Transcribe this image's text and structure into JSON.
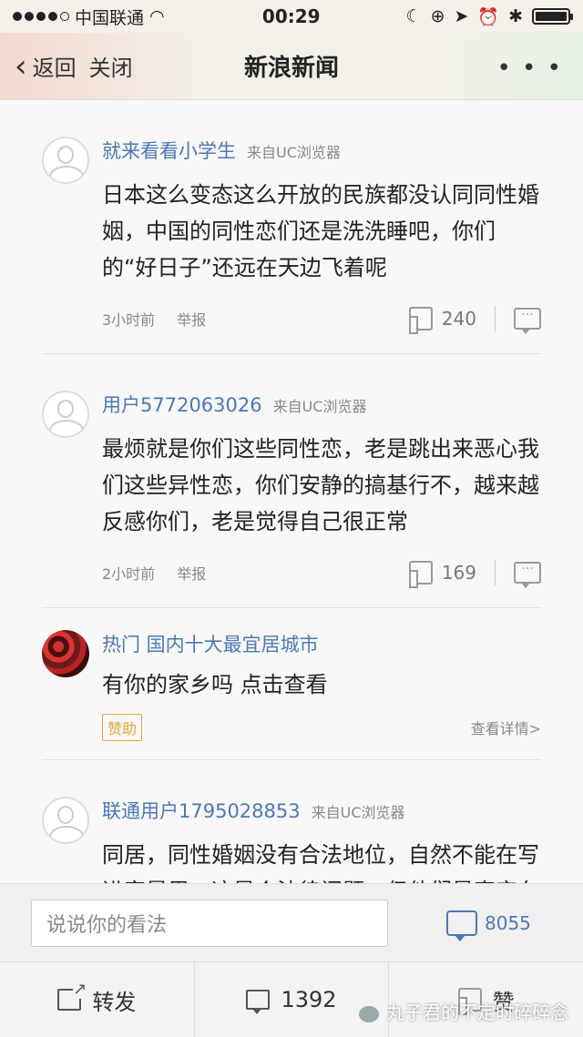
{
  "status": {
    "carrier": "中国联通",
    "time": "00:29"
  },
  "nav": {
    "back_label": "返回",
    "close_label": "关闭",
    "title": "新浪新闻",
    "more_label": "• • •"
  },
  "comments": [
    {
      "user": "就来看看小学生",
      "source": "来自UC浏览器",
      "text": "日本这么变态这么开放的民族都没认同同性婚姻，中国的同性恋们还是洗洗睡吧，你们的“好日子”还远在天边飞着呢",
      "time": "3小时前",
      "report": "举报",
      "likes": "240"
    },
    {
      "user": "用户5772063026",
      "source": "来自UC浏览器",
      "text": "最烦就是你们这些同性恋，老是跳出来恶心我们这些异性恋，你们安静的搞基行不，越来越反感你们，老是觉得自己很正常",
      "time": "2小时前",
      "report": "举报",
      "likes": "169"
    },
    {
      "user": "联通用户1795028853",
      "source": "来自UC浏览器",
      "text": "同居，同性婚姻没有合法地位，自然不能在写进家暴里，这是个法律问题。但他们是真实存在的群体，理应受到法律保护，不受歧视和伤害！生命的意义在于健康的生活，他们在社会层面就不健康，所以政府和社会应该为他们提供治疗服务"
    }
  ],
  "ad": {
    "title": "热门 国内十大最宜居城市",
    "text": "有你的家乡吗 点击查看",
    "badge": "赞助",
    "detail": "查看详情>"
  },
  "input": {
    "placeholder": "说说你的看法",
    "comment_count": "8055"
  },
  "toolbar": {
    "share_label": "转发",
    "comments_count": "1392",
    "like_label": "赞"
  },
  "watermark": "丸子君的不定时碎碎念",
  "colors": {
    "link_blue": "#4c78b3",
    "sponsor_orange": "#e3a63a"
  }
}
